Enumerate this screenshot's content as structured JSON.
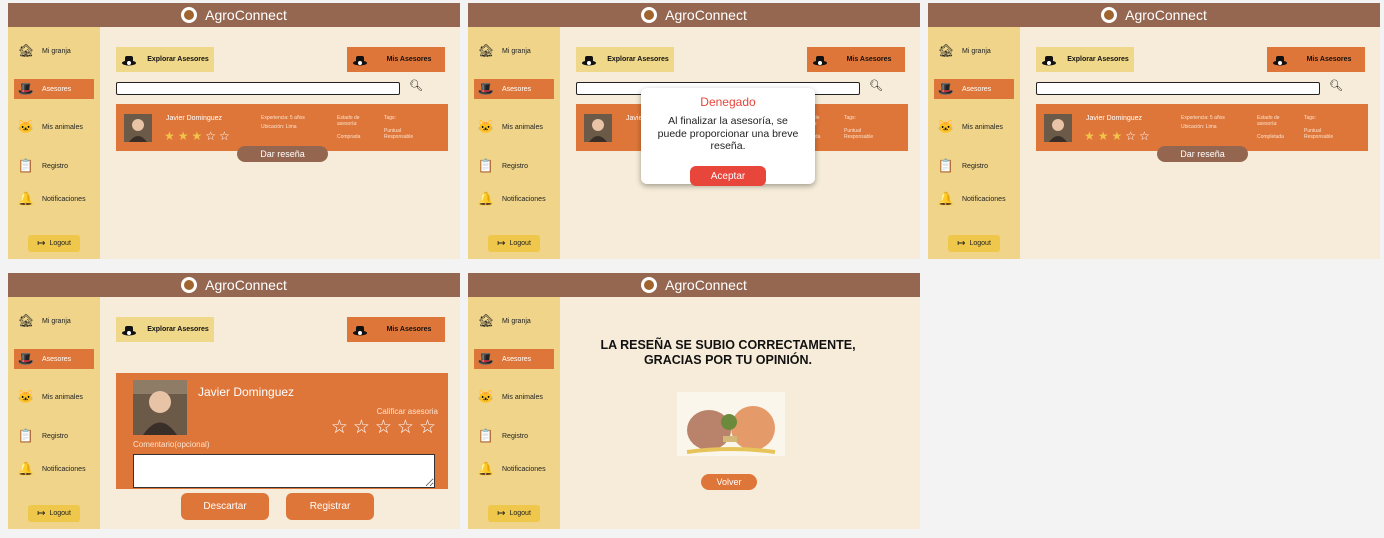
{
  "app": {
    "title": "AgroConnect"
  },
  "sidebar": {
    "items": [
      {
        "label": "Mi granja",
        "icon": "barn-icon"
      },
      {
        "label": "Asesores",
        "icon": "farmer-hat-icon"
      },
      {
        "label": "Mis animales",
        "icon": "cat-face-icon"
      },
      {
        "label": "Registro",
        "icon": "clipboard-icon"
      },
      {
        "label": "Notificaciones",
        "icon": "bell-icon"
      }
    ],
    "logout": "Logout"
  },
  "toolbar": {
    "explore": "Explorar Asesores",
    "mine": "Mis Asesores"
  },
  "search": {
    "placeholder": ""
  },
  "advisor": {
    "name": "Javier Dominguez",
    "experience": "Experiencia: 5 años",
    "location": "Ubicación: Lima",
    "status_label": "Estado de asesoría:",
    "status_value_1": "Comprada",
    "status_value_3": "Completada",
    "tags_label": "Tags:",
    "tags": "Puntual Responsable",
    "rating": 3,
    "rating_max": 5
  },
  "review_button": "Dar reseña",
  "dialog": {
    "title": "Denegado",
    "message": "Al finalizar la asesoría, se puede proporcionar una breve reseña.",
    "accept": "Aceptar"
  },
  "review_form": {
    "rate_label": "Calificar asesoria",
    "comment_label": "Comentario(opcional)",
    "discard": "Descartar",
    "submit": "Registrar"
  },
  "success": {
    "message": "LA RESEÑA SE SUBIO CORRECTAMENTE, GRACIAS POR TU OPINIÓN.",
    "back": "Volver"
  },
  "colors": {
    "topbar": "#956650",
    "sidebar": "#efd489",
    "accent": "#df7639",
    "background": "#f6ecd9",
    "danger": "#e8453b",
    "star": "#f2c34b"
  }
}
